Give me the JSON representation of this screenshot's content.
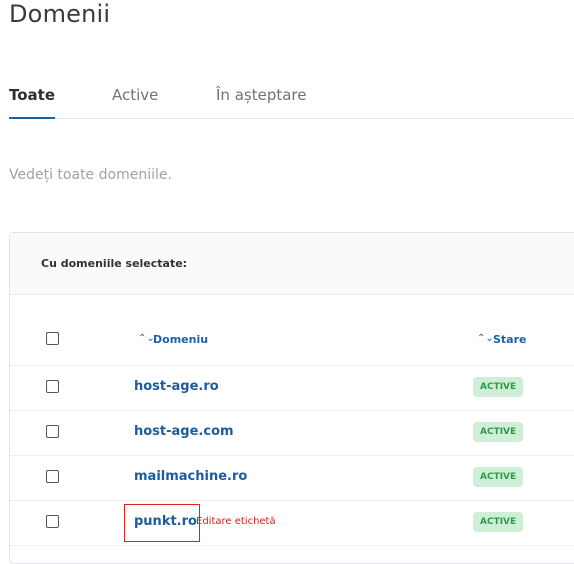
{
  "page": {
    "title": "Domenii",
    "subtitle": "Vedeți toate domeniile."
  },
  "tabs": [
    {
      "label": "Toate",
      "active": true
    },
    {
      "label": "Active",
      "active": false
    },
    {
      "label": "În așteptare",
      "active": false
    }
  ],
  "table": {
    "bulk_label": "Cu domeniile selectate:",
    "columns": {
      "domain": "Domeniu",
      "status": "Stare"
    },
    "rows": [
      {
        "domain": "host-age.ro",
        "status": "ACTIVE"
      },
      {
        "domain": "host-age.com",
        "status": "ACTIVE"
      },
      {
        "domain": "mailmachine.ro",
        "status": "ACTIVE"
      },
      {
        "domain": "punkt.ro",
        "status": "ACTIVE",
        "edit_label": "Editare etichetă"
      }
    ]
  },
  "colors": {
    "accent": "#1f5fa8",
    "active_badge_bg": "#cfeed6",
    "active_badge_text": "#2f9a4c",
    "highlight": "#e02020"
  },
  "icons": {
    "sort": "sort-updown-icon"
  }
}
